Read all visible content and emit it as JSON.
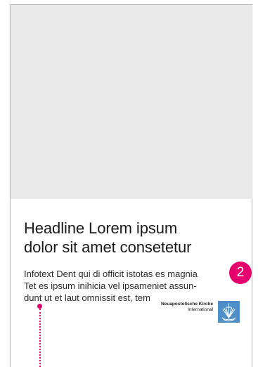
{
  "layout_preview": {
    "headline": [
      "Headline Lorem ipsum",
      "dolor sit amet consetetur"
    ],
    "infotext": [
      "Infotext Dent qui di officit istotas es magnia",
      "Tet es ipsum inihicia vel ipsameniet assun-",
      "dunt ut et laut omnissit est, tem"
    ],
    "marker_number": "2",
    "logo": {
      "name": "Neuapostolische Kirche",
      "subtitle": "International"
    }
  },
  "colors": {
    "accent": "#e5006d",
    "logo_blue": "#4f8fc8",
    "image_placeholder": "#e9e9e9",
    "text": "#1b1b1b"
  },
  "icons": {
    "logo_mark": "church-cross-icon"
  }
}
